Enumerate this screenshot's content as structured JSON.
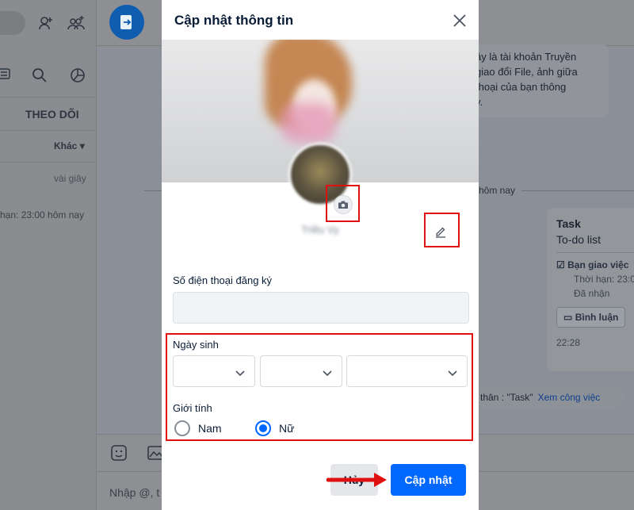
{
  "background": {
    "sidebar": {
      "tab_label": "THEO DÕI",
      "filter_label": "Khác",
      "item_time": "vài giây",
      "item_deadline": "hạn: 23:00 hôm nay"
    },
    "chat": {
      "message_lines": [
        "ây là tài khoản Truyền",
        "giao đổi File, ảnh giữa",
        "thoại của bạn thông",
        "y."
      ],
      "date_divider": "hôm nay",
      "task_card": {
        "title": "Task",
        "subtitle": "To-do list",
        "item": "Bạn giao việc",
        "deadline": "Thời hạn: 23:0",
        "status": "Đã nhận",
        "comment_button": "Bình luận",
        "time": "22:28"
      },
      "task_footer": {
        "text": "thân : \"Task\"",
        "link": "Xem công việc"
      },
      "composer_placeholder": "Nhập @, t"
    }
  },
  "modal": {
    "title": "Cập nhật thông tin",
    "display_name": "Triều Vy",
    "phone_label": "Số điện thoại đăng ký",
    "phone_value": "",
    "birthday_label": "Ngày sinh",
    "birthday": {
      "day": "",
      "month": "",
      "year": ""
    },
    "gender_label": "Giới tính",
    "gender_options": [
      {
        "label": "Nam",
        "selected": false
      },
      {
        "label": "Nữ",
        "selected": true
      }
    ],
    "cancel_label": "Hủy",
    "update_label": "Cập nhật"
  },
  "colors": {
    "accent": "#0068ff",
    "annotation_red": "#e01010",
    "overlay": "#8b8d90"
  },
  "icons": [
    "close-icon",
    "camera-icon",
    "pencil-icon",
    "chevron-down-icon",
    "red-arrow-icon",
    "add-friend-icon",
    "add-group-icon",
    "search-icon",
    "chart-icon",
    "sticker-icon",
    "image-icon"
  ]
}
